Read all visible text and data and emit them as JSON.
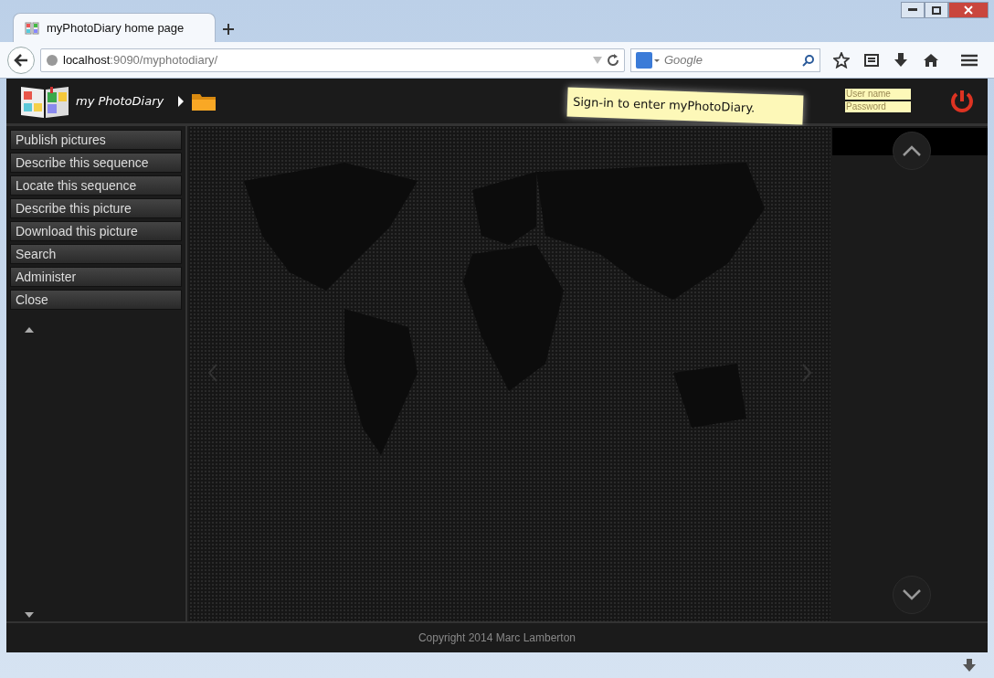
{
  "browser": {
    "tab_title": "myPhotoDiary home page",
    "address_host": "localhost",
    "address_rest": ":9090/myphotodiary/",
    "search_placeholder": "Google"
  },
  "header": {
    "brand": "my PhotoDiary",
    "note": "Sign-in to enter myPhotoDiary.",
    "username_placeholder": "User name",
    "password_placeholder": "Password"
  },
  "menu": [
    "Publish pictures",
    "Describe this sequence",
    "Locate this sequence",
    "Describe this picture",
    "Download this picture",
    "Search",
    "Administer",
    "Close"
  ],
  "footer": "Copyright 2014 Marc Lamberton"
}
